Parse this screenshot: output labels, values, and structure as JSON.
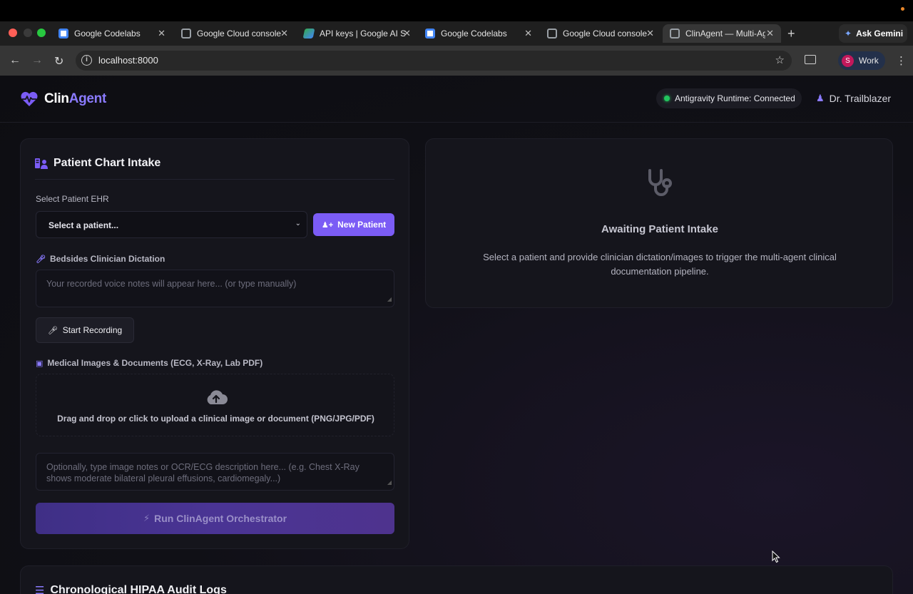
{
  "browser": {
    "tabs": [
      {
        "title": "Google Codelabs",
        "icon": "codelabs-icon"
      },
      {
        "title": "Google Cloud console",
        "icon": "cloud-console-icon"
      },
      {
        "title": "API keys | Google AI S",
        "icon": "ai-studio-icon"
      },
      {
        "title": "Google Codelabs",
        "icon": "codelabs-icon"
      },
      {
        "title": "Google Cloud console",
        "icon": "cloud-console-icon"
      },
      {
        "title": "ClinAgent — Multi-Ag",
        "icon": "globe-icon",
        "active": true
      }
    ],
    "ask_gemini": "Ask Gemini",
    "url": "localhost:8000",
    "profile_initial": "S",
    "profile_label": "Work"
  },
  "app": {
    "logo_part1": "Clin",
    "logo_part2": "Agent",
    "runtime_status": "Antigravity Runtime: Connected",
    "user_name": "Dr. Trailblazer",
    "accent": "#7b5cf5",
    "status_color": "#22c55e"
  },
  "intake": {
    "title": "Patient Chart Intake",
    "select_label": "Select Patient EHR",
    "select_value": "Select a patient...",
    "new_patient": "New Patient",
    "dictation_label": "Bedsides Clinician Dictation",
    "dictation_placeholder": "Your recorded voice notes will appear here... (or type manually)",
    "record_button": "Start Recording",
    "images_label": "Medical Images & Documents (ECG, X-Ray, Lab PDF)",
    "dropzone_text": "Drag and drop or click to upload a clinical image or document (PNG/JPG/PDF)",
    "image_notes_placeholder": "Optionally, type image notes or OCR/ECG description here... (e.g. Chest X-Ray shows moderate bilateral pleural effusions, cardiomegaly...)",
    "run_button": "Run ClinAgent Orchestrator"
  },
  "awaiting": {
    "title": "Awaiting Patient Intake",
    "description": "Select a patient and provide clinician dictation/images to trigger the multi-agent clinical documentation pipeline."
  },
  "audit": {
    "title": "Chronological HIPAA Audit Logs"
  }
}
